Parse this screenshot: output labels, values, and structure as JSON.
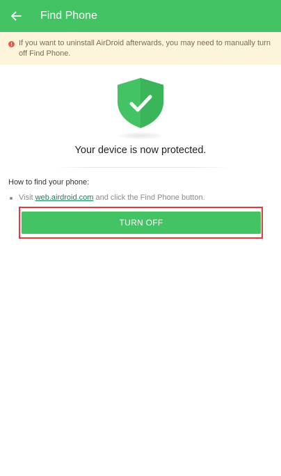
{
  "header": {
    "title": "Find Phone",
    "back_icon": "arrow-left-icon"
  },
  "warning": {
    "icon": "alert-circle-icon",
    "text": "If you want to uninstall AirDroid afterwards, you may need to manually turn off Find Phone."
  },
  "status": {
    "icon": "shield-check-icon",
    "message": "Your device is now protected."
  },
  "howto": {
    "title": "How to find your phone:",
    "instruction_prefix": "Visit ",
    "link_text": "web.airdroid.com",
    "instruction_suffix": " and click the Find Phone button."
  },
  "actions": {
    "turn_off_label": "TURN OFF"
  },
  "colors": {
    "brand_green": "#44c365",
    "warning_bg": "#fcf5dc",
    "highlight_red": "#e23b3b",
    "link": "#178060"
  }
}
